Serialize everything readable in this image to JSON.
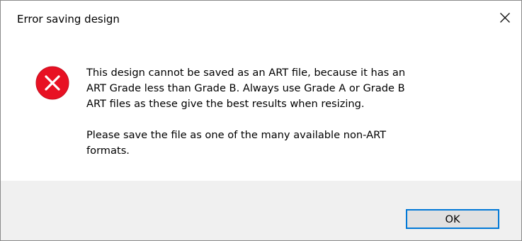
{
  "dialog": {
    "title": "Error saving design",
    "icon": "error-icon",
    "icon_color": "#e81123",
    "message_paragraph_1": "This design cannot be saved as an ART file, because it has an\nART Grade less than Grade B. Always use Grade A or Grade B\nART files as these give the best results when resizing.",
    "message_paragraph_2": "Please save the file as one of the many available non-ART\nformats.",
    "ok_label": "OK",
    "accent_color": "#0078d7"
  }
}
